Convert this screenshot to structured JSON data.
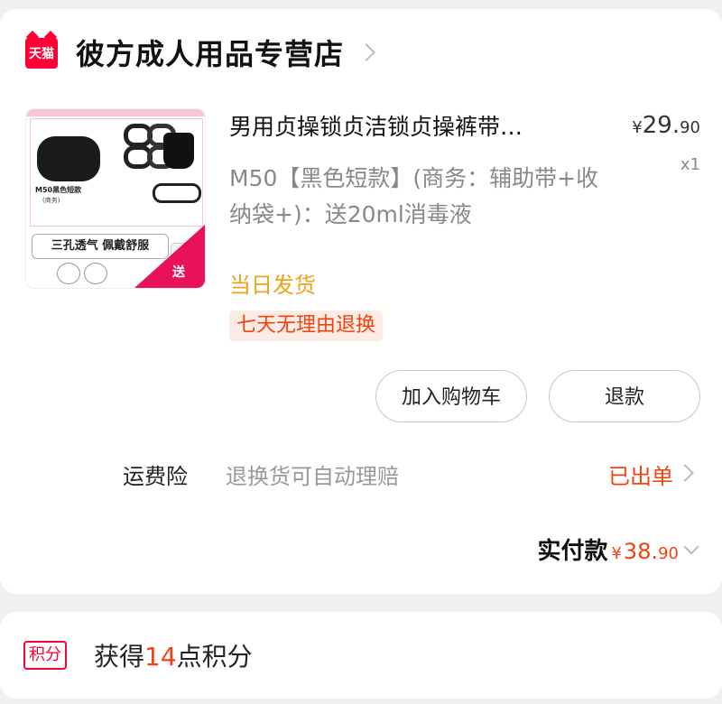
{
  "store": {
    "logo_text": "天猫",
    "name": "彼方成人用品专营店"
  },
  "product": {
    "title": "男用贞操锁贞洁锁贞操裤带…",
    "price_yen": "¥",
    "price_int": "29.",
    "price_dec": "90",
    "quantity": "x1",
    "sku": "M50【黑色短款】(商务：辅助带+收纳袋+)：送20ml消毒液",
    "ship_tag": "当日发货",
    "return_tag": "七天无理由退换",
    "image": {
      "caption_model": "M50黑色短款",
      "caption_sub": "(商务)",
      "slogan": "三孔透气 佩戴舒服",
      "gift": "送"
    }
  },
  "actions": {
    "add_to_cart": "加入购物车",
    "refund": "退款"
  },
  "insurance": {
    "label": "运费险",
    "desc": "退换货可自动理赔",
    "status": "已出单"
  },
  "paid": {
    "label": "实付款",
    "yen": "¥",
    "int": "38.",
    "dec": "90"
  },
  "points": {
    "badge": "积分",
    "prefix": "获得",
    "value": "14",
    "suffix": "点积分"
  },
  "colors": {
    "accent_red": "#f1420f",
    "tmall_red": "#ff0036",
    "ship_orange": "#f0a21a"
  }
}
